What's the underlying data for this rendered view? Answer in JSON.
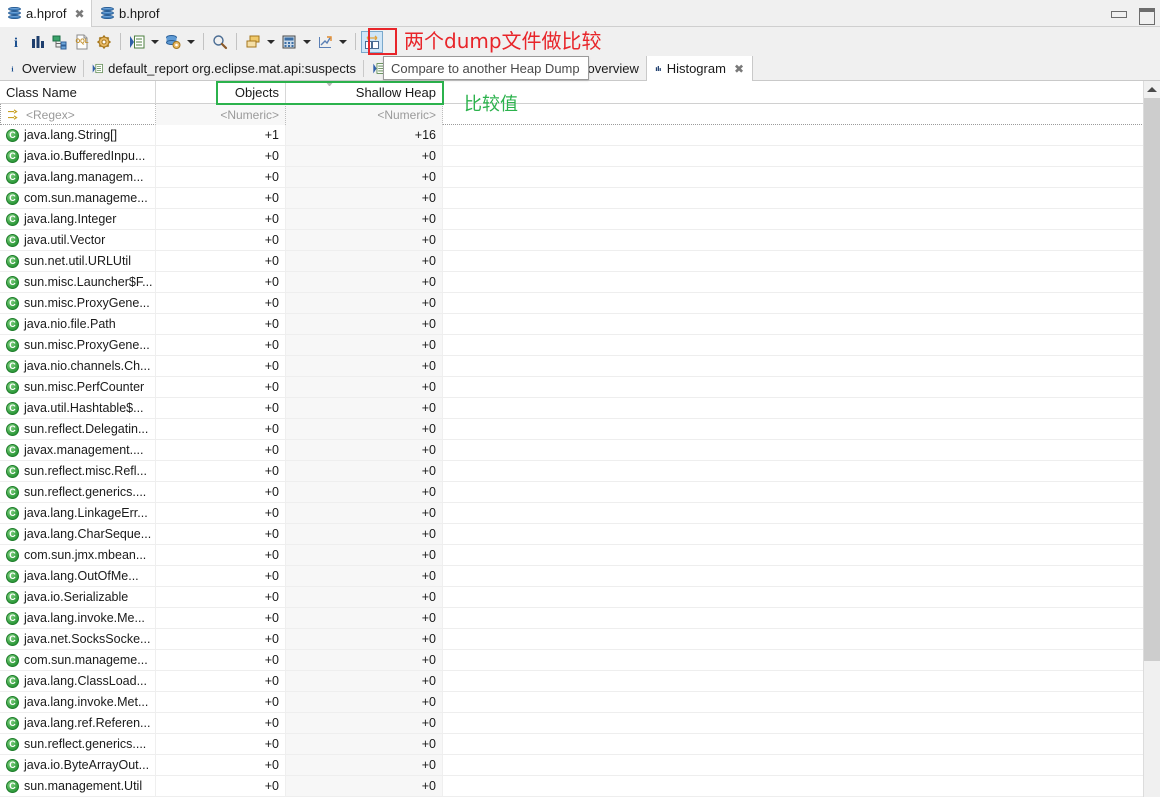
{
  "window": {
    "minimize_label": "minimize",
    "restore_label": "restore"
  },
  "editor_tabs": [
    {
      "label": "a.hprof",
      "icon": "heap-dump-icon",
      "active": true,
      "closeable": true,
      "close_glyph": "✖"
    },
    {
      "label": "b.hprof",
      "icon": "heap-dump-icon",
      "active": false,
      "closeable": false,
      "close_glyph": ""
    }
  ],
  "toolbar": {
    "items": [
      {
        "name": "overview-info-button",
        "icon": "info-icon",
        "glyph": "i"
      },
      {
        "name": "histogram-button",
        "icon": "histogram-bars-icon",
        "glyph": ""
      },
      {
        "name": "dominator-tree-button",
        "icon": "tree-icon",
        "glyph": ""
      },
      {
        "name": "oql-button",
        "icon": "oql-document-icon",
        "glyph": "OQL"
      },
      {
        "name": "run-expert-system-button",
        "icon": "gear-icon",
        "glyph": ""
      },
      {
        "name": "open-query-browser-button",
        "icon": "query-list-icon",
        "glyph": ""
      },
      {
        "name": "heap-dump-actions-button",
        "icon": "heap-gear-icon",
        "glyph": ""
      },
      {
        "name": "find-button",
        "icon": "search-icon",
        "glyph": ""
      },
      {
        "name": "group-result-button",
        "icon": "group-windows-icon",
        "glyph": ""
      },
      {
        "name": "calculator-button",
        "icon": "calculator-icon",
        "glyph": ""
      },
      {
        "name": "export-chart-button",
        "icon": "export-arrow-icon",
        "glyph": ""
      },
      {
        "name": "compare-heap-dump-button",
        "icon": "compare-dumps-icon",
        "glyph": ""
      }
    ],
    "compare_tooltip": "Compare to another Heap Dump"
  },
  "annotations": {
    "red_note": "两个dump文件做比较",
    "red_color": "#e8252a",
    "green_note": "比较值",
    "green_color": "#2bb24c"
  },
  "view_tabs": [
    {
      "label": "Overview",
      "icon": "info-icon",
      "active": false
    },
    {
      "label": "default_report org.eclipse.mat.api:suspects",
      "icon": "report-icon",
      "active": false
    },
    {
      "label": "default_report org.eclipse.mat.api:overview",
      "icon": "report-icon",
      "active": false,
      "short_label": "overview"
    },
    {
      "label": "Histogram",
      "icon": "histogram-bars-icon",
      "active": true,
      "closeable": true,
      "close_glyph": "✖"
    }
  ],
  "table": {
    "columns": [
      {
        "key": "class_name",
        "label": "Class Name",
        "align": "left",
        "filter": "<Regex>"
      },
      {
        "key": "objects",
        "label": "Objects",
        "align": "right",
        "filter": "<Numeric>"
      },
      {
        "key": "shallow_heap",
        "label": "Shallow Heap",
        "align": "right",
        "filter": "<Numeric>"
      }
    ],
    "sorted_column": "shallow_heap",
    "rows": [
      {
        "class_name": "java.lang.String[]",
        "objects": "+1",
        "shallow_heap": "+16"
      },
      {
        "class_name": "java.io.BufferedInpu...",
        "objects": "+0",
        "shallow_heap": "+0"
      },
      {
        "class_name": "java.lang.managem...",
        "objects": "+0",
        "shallow_heap": "+0"
      },
      {
        "class_name": "com.sun.manageme...",
        "objects": "+0",
        "shallow_heap": "+0"
      },
      {
        "class_name": "java.lang.Integer",
        "objects": "+0",
        "shallow_heap": "+0"
      },
      {
        "class_name": "java.util.Vector",
        "objects": "+0",
        "shallow_heap": "+0"
      },
      {
        "class_name": "sun.net.util.URLUtil",
        "objects": "+0",
        "shallow_heap": "+0"
      },
      {
        "class_name": "sun.misc.Launcher$F...",
        "objects": "+0",
        "shallow_heap": "+0"
      },
      {
        "class_name": "sun.misc.ProxyGene...",
        "objects": "+0",
        "shallow_heap": "+0"
      },
      {
        "class_name": "java.nio.file.Path",
        "objects": "+0",
        "shallow_heap": "+0"
      },
      {
        "class_name": "sun.misc.ProxyGene...",
        "objects": "+0",
        "shallow_heap": "+0"
      },
      {
        "class_name": "java.nio.channels.Ch...",
        "objects": "+0",
        "shallow_heap": "+0"
      },
      {
        "class_name": "sun.misc.PerfCounter",
        "objects": "+0",
        "shallow_heap": "+0"
      },
      {
        "class_name": "java.util.Hashtable$...",
        "objects": "+0",
        "shallow_heap": "+0"
      },
      {
        "class_name": "sun.reflect.Delegatin...",
        "objects": "+0",
        "shallow_heap": "+0"
      },
      {
        "class_name": "javax.management....",
        "objects": "+0",
        "shallow_heap": "+0"
      },
      {
        "class_name": "sun.reflect.misc.Refl...",
        "objects": "+0",
        "shallow_heap": "+0"
      },
      {
        "class_name": "sun.reflect.generics....",
        "objects": "+0",
        "shallow_heap": "+0"
      },
      {
        "class_name": "java.lang.LinkageErr...",
        "objects": "+0",
        "shallow_heap": "+0"
      },
      {
        "class_name": "java.lang.CharSeque...",
        "objects": "+0",
        "shallow_heap": "+0"
      },
      {
        "class_name": "com.sun.jmx.mbean...",
        "objects": "+0",
        "shallow_heap": "+0"
      },
      {
        "class_name": "java.lang.OutOfMe...",
        "objects": "+0",
        "shallow_heap": "+0"
      },
      {
        "class_name": "java.io.Serializable",
        "objects": "+0",
        "shallow_heap": "+0"
      },
      {
        "class_name": "java.lang.invoke.Me...",
        "objects": "+0",
        "shallow_heap": "+0"
      },
      {
        "class_name": "java.net.SocksSocke...",
        "objects": "+0",
        "shallow_heap": "+0"
      },
      {
        "class_name": "com.sun.manageme...",
        "objects": "+0",
        "shallow_heap": "+0"
      },
      {
        "class_name": "java.lang.ClassLoad...",
        "objects": "+0",
        "shallow_heap": "+0"
      },
      {
        "class_name": "java.lang.invoke.Met...",
        "objects": "+0",
        "shallow_heap": "+0"
      },
      {
        "class_name": "java.lang.ref.Referen...",
        "objects": "+0",
        "shallow_heap": "+0"
      },
      {
        "class_name": "sun.reflect.generics....",
        "objects": "+0",
        "shallow_heap": "+0"
      },
      {
        "class_name": "java.io.ByteArrayOut...",
        "objects": "+0",
        "shallow_heap": "+0"
      },
      {
        "class_name": "sun.management.Util",
        "objects": "+0",
        "shallow_heap": "+0"
      }
    ]
  }
}
